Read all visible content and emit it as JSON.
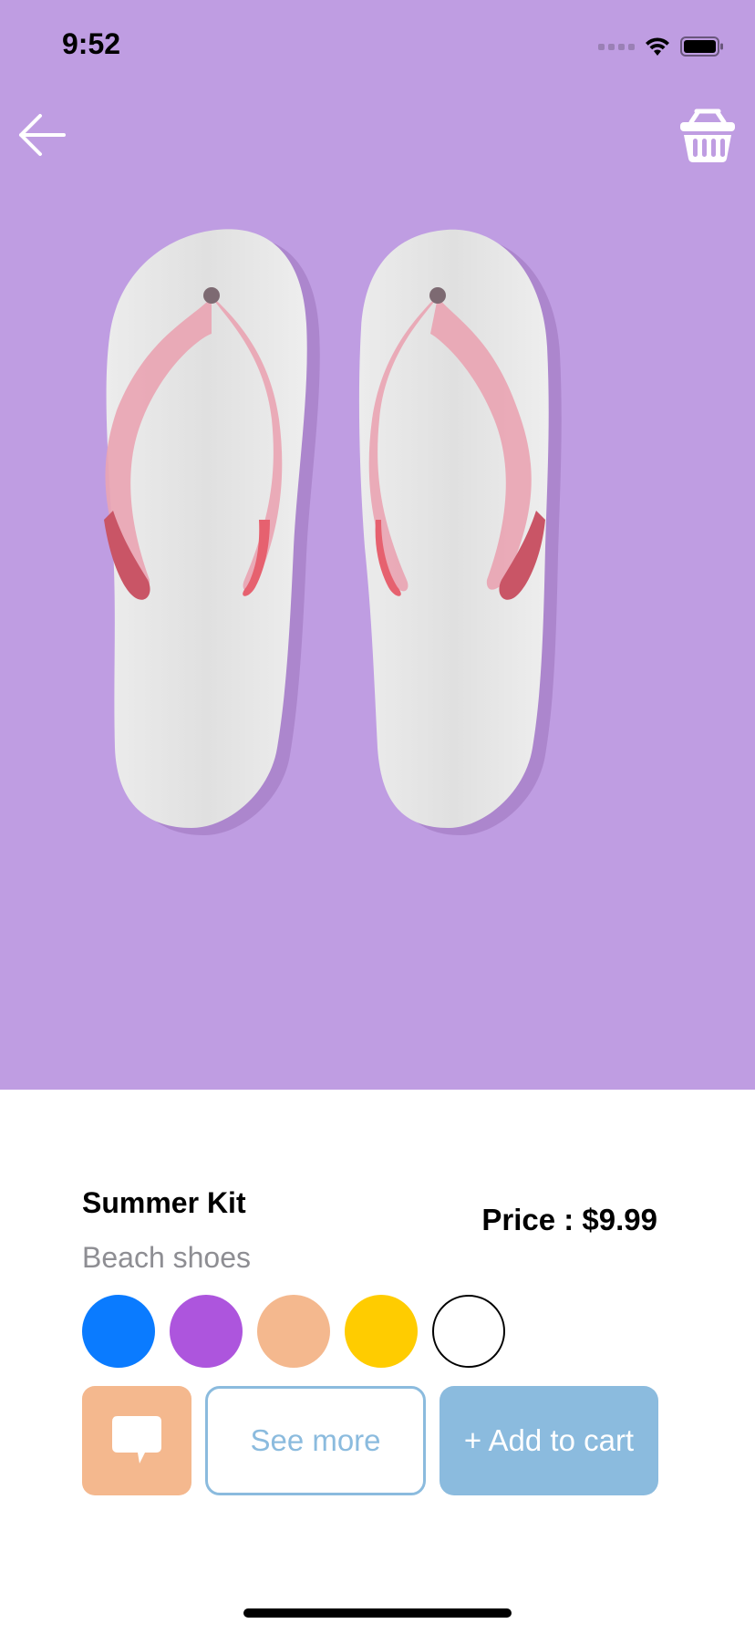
{
  "status_bar": {
    "time": "9:52",
    "icons": [
      "signal-icon",
      "wifi-icon",
      "battery-icon"
    ]
  },
  "hero": {
    "background_color": "#bf9de2",
    "back_icon": "arrow-left-icon",
    "cart_icon": "shopping-basket-icon",
    "image": "flip-flops-illustration"
  },
  "product": {
    "name": "Summer Kit",
    "subtitle": "Beach shoes",
    "price_label": "Price : $9.99"
  },
  "colors": [
    {
      "name": "blue",
      "hex": "#0a7bff"
    },
    {
      "name": "purple",
      "hex": "#ad55dd"
    },
    {
      "name": "peach",
      "hex": "#f4b88e"
    },
    {
      "name": "yellow",
      "hex": "#ffcc00"
    },
    {
      "name": "white",
      "hex": "#ffffff"
    }
  ],
  "actions": {
    "chat_icon": "chat-bubble-icon",
    "see_more_label": "See more",
    "add_to_cart_label": "+ Add to cart"
  },
  "theme": {
    "accent_blue": "#8bbbde",
    "accent_peach": "#f4b88e"
  }
}
